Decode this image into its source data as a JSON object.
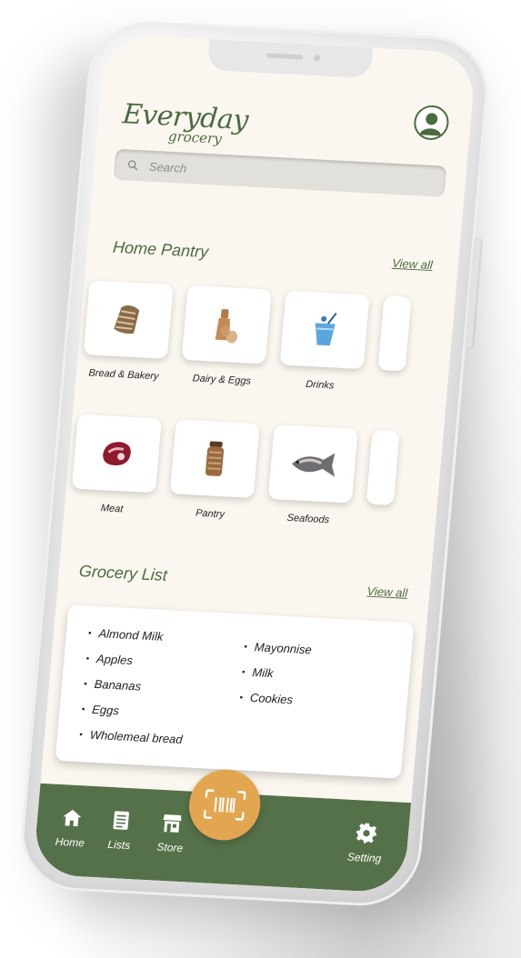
{
  "app": {
    "brand": "Everyday",
    "brand_sub": "grocery"
  },
  "search": {
    "placeholder": "Search"
  },
  "home_pantry": {
    "title": "Home Pantry",
    "view_all": "View all",
    "row1": [
      {
        "label": "Bread & Bakery",
        "icon": "bread-icon"
      },
      {
        "label": "Dairy & Eggs",
        "icon": "dairy-eggs-icon"
      },
      {
        "label": "Drinks",
        "icon": "drink-icon"
      }
    ],
    "row2": [
      {
        "label": "Meat",
        "icon": "meat-icon"
      },
      {
        "label": "Pantry",
        "icon": "pantry-jar-icon"
      },
      {
        "label": "Seafoods",
        "icon": "fish-icon"
      }
    ]
  },
  "grocery_list": {
    "title": "Grocery List",
    "view_all": "View all",
    "column1": [
      "Almond Milk",
      "Apples",
      "Bananas",
      "Eggs",
      "Wholemeal bread"
    ],
    "column2": [
      "Mayonnise",
      "Milk",
      "Cookies"
    ]
  },
  "tabbar": {
    "home": "Home",
    "lists": "Lists",
    "store": "Store",
    "setting": "Setting",
    "scan_icon": "barcode-scan-icon"
  },
  "colors": {
    "accent_green": "#557149",
    "scan_orange": "#e2a650",
    "screen_bg": "#fbf7f0"
  }
}
